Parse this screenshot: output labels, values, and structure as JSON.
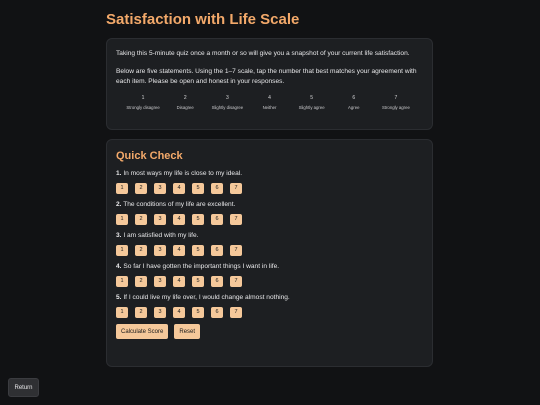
{
  "page": {
    "title": "Satisfaction with Life Scale"
  },
  "intro": {
    "paragraph1": "Taking this 5-minute quiz once a month or so will give you a snapshot of your current life satisfaction.",
    "paragraph2": "Below are five statements. Using the 1–7 scale, tap the number that best matches your agreement with each item. Please be open and honest in your responses.",
    "scale": [
      {
        "num": "1",
        "label": "Strongly disagree"
      },
      {
        "num": "2",
        "label": "Disagree"
      },
      {
        "num": "3",
        "label": "Slightly disagree"
      },
      {
        "num": "4",
        "label": "Neither"
      },
      {
        "num": "5",
        "label": "Slightly agree"
      },
      {
        "num": "6",
        "label": "Agree"
      },
      {
        "num": "7",
        "label": "Strongly agree"
      }
    ]
  },
  "quiz": {
    "title": "Quick Check",
    "options": [
      "1",
      "2",
      "3",
      "4",
      "5",
      "6",
      "7"
    ],
    "questions": [
      {
        "num": "1.",
        "text": "In most ways my life is close to my ideal."
      },
      {
        "num": "2.",
        "text": "The conditions of my life are excellent."
      },
      {
        "num": "3.",
        "text": "I am satisfied with my life."
      },
      {
        "num": "4.",
        "text": "So far I have gotten the important things I want in life."
      },
      {
        "num": "5.",
        "text": "If I could live my life over, I would change almost nothing."
      }
    ],
    "calculate_label": "Calculate Score",
    "reset_label": "Reset"
  },
  "nav": {
    "return_label": "Return"
  },
  "colors": {
    "accent": "#f3a96a",
    "button": "#f5c89a",
    "background": "#111214",
    "card": "#1d1f22"
  }
}
